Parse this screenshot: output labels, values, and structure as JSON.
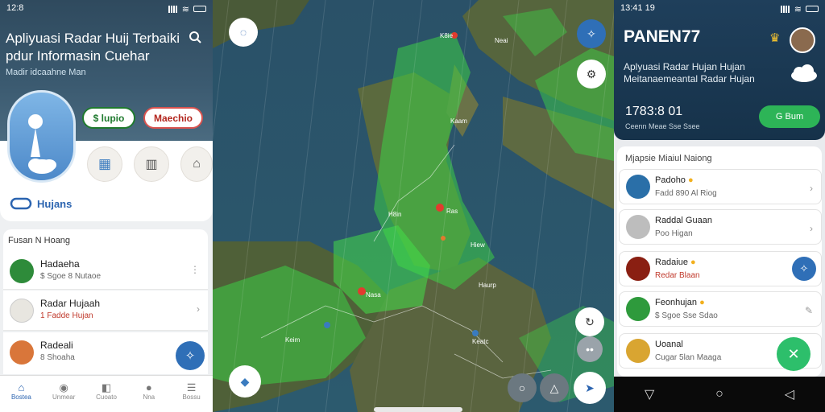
{
  "left": {
    "status_time": "12:8",
    "title": "Apliyuasi Radar Huij Terbaiki pdur Informasin Cuehar",
    "subtitle": "Madir idcaahne Man",
    "pill_green": "$ lupio",
    "pill_red": "Maechio",
    "brand_label": "Hujans",
    "section_title": "Fusan N Hoang",
    "rows": [
      {
        "title": "Hadaeha",
        "sub": "$ Sgoe 8 Nutaoe",
        "color": "#2e8b3a"
      },
      {
        "title": "Radar Hujaah",
        "sub": "1 Fadde Hujan",
        "color": "#e8e6e0"
      },
      {
        "title": "Radeali",
        "sub": "8 Shoaha",
        "color": "#d9763a"
      }
    ],
    "nav": [
      "Bostea",
      "Unmear",
      "Cuoato",
      "Nna",
      "Bossu"
    ]
  },
  "map": {
    "labels": [
      "K8ie",
      "Neai",
      "Kaam",
      "H8in",
      "Ras",
      "Hiew",
      "Nasa",
      "Keim",
      "Keatc",
      "Haurp"
    ]
  },
  "right": {
    "status_time": "13:41 19",
    "brand": "PANEN77",
    "tagline": "Aplyuasi Radar Hujan Hujan Meitanaemeantal Radar Hujan",
    "stat_value": "1783:8 01",
    "stat_sub": "Ceenn Meae Sse Ssee",
    "cta": "G Bum",
    "list_title": "Mjapsie Miaiul Naiong",
    "rows": [
      {
        "title": "Padoho",
        "sub": "Fadd 890 Al Riog",
        "color": "#2a6fa8"
      },
      {
        "title": "Raddal Guaan",
        "sub": "Poo Higan",
        "color": "#b7b7b7"
      },
      {
        "title": "Radaiue",
        "sub": "Redar Blaan",
        "color": "#8a1f12"
      },
      {
        "title": "Feonhujan",
        "sub": "$ Sgoe Sse Sdao",
        "color": "#2e9a3c"
      },
      {
        "title": "Uoanal",
        "sub": "Cugar 5lan Maaga",
        "color": "#d9a531"
      }
    ]
  }
}
